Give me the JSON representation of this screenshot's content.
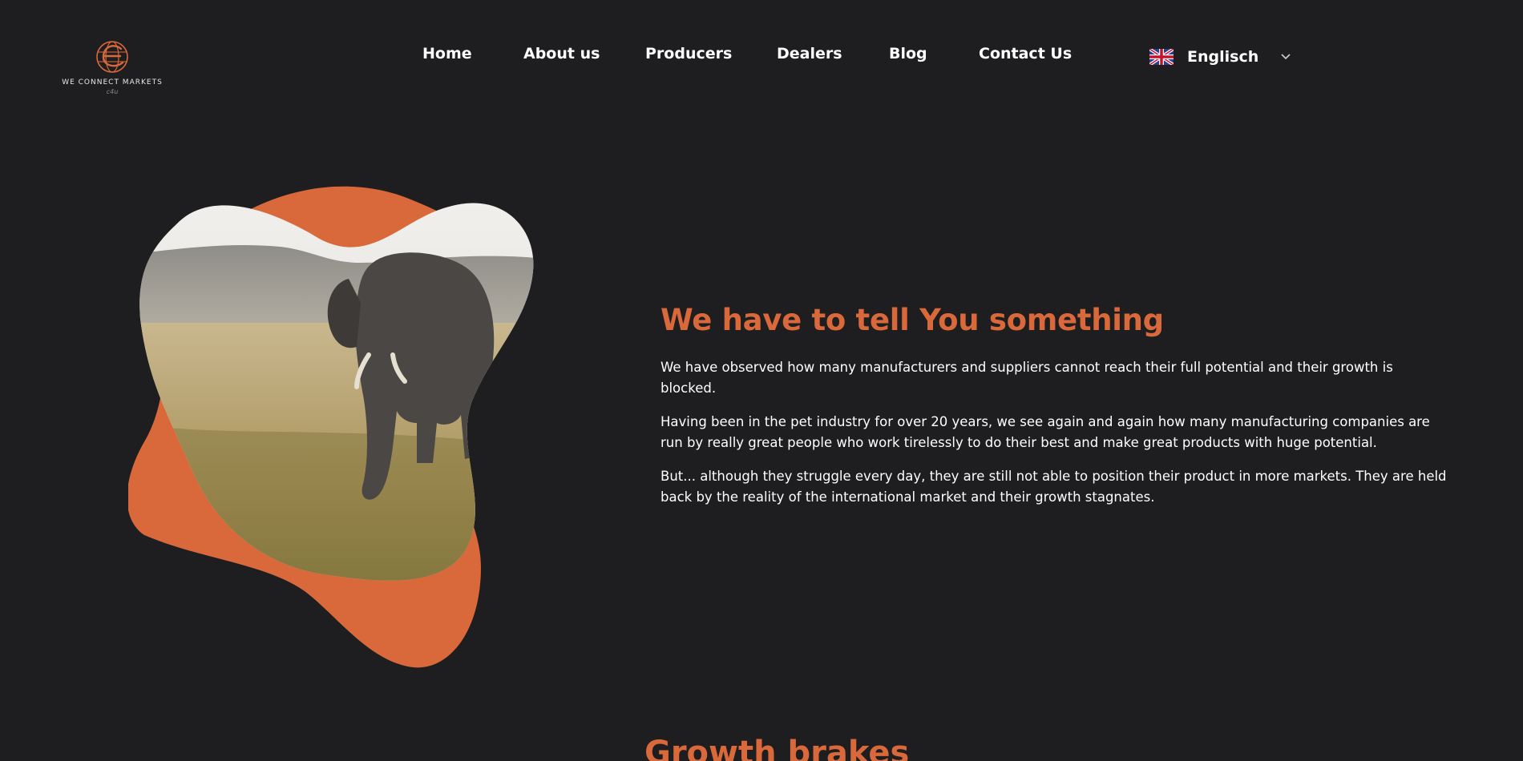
{
  "header": {
    "logo": {
      "name": "WE CONNECT MARKETS",
      "sub": "c4u"
    },
    "nav": [
      {
        "label": "Home"
      },
      {
        "label": "About us"
      },
      {
        "label": "Producers"
      },
      {
        "label": "Dealers"
      },
      {
        "label": "Blog"
      },
      {
        "label": "Contact Us"
      }
    ],
    "language": {
      "label": "Englisch",
      "flag_icon": "uk-flag-icon",
      "caret_icon": "chevron-down-icon"
    }
  },
  "hero": {
    "image_subject": "elephant in savanna",
    "title": "We have to tell You something",
    "paragraphs": [
      "We have observed how many manufacturers and suppliers cannot reach their full potential and their growth is blocked.",
      "Having been in the pet industry for over 20 years, we see again and again how many manufacturing companies are run by really great people who work tirelessly to do their best and make great products with huge potential.",
      "But... although they struggle every day, they are still not able to position their product in more markets. They are held back by the reality of the international market and their growth stagnates."
    ]
  },
  "next_section": {
    "title": "Growth brakes"
  },
  "colors": {
    "background": "#1e1d1f",
    "accent": "#d9693b",
    "text": "#ffffff"
  }
}
